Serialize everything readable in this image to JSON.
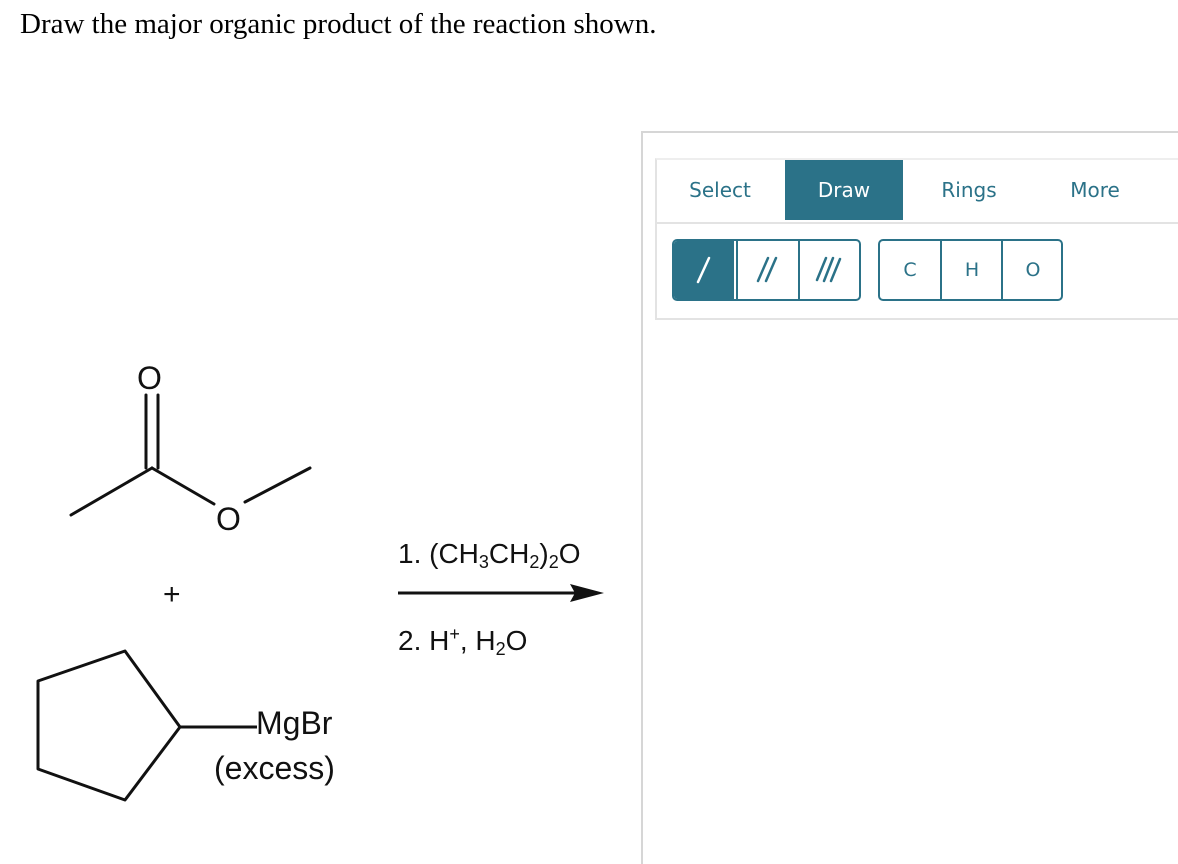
{
  "question": "Draw the major organic product of the reaction shown.",
  "reaction": {
    "ester_carbonyl_o": "O",
    "ester_o": "O",
    "plus": "+",
    "grignard_group": "MgBr",
    "grignard_note": "(excess)",
    "step1_label": "1. (CH",
    "step1_sub1": "3",
    "step1_mid": "CH",
    "step1_sub2": "2",
    "step1_paren": ")",
    "step1_sub3": "2",
    "step1_end": "O",
    "step2_label": "2. H",
    "step2_sup": "+",
    "step2_mid": ", H",
    "step2_sub": "2",
    "step2_end": "O"
  },
  "editor": {
    "tabs": [
      {
        "label": "Select",
        "active": false
      },
      {
        "label": "Draw",
        "active": true
      },
      {
        "label": "Rings",
        "active": false
      },
      {
        "label": "More",
        "active": false
      }
    ],
    "bonds": [
      {
        "name": "single-bond",
        "active": true
      },
      {
        "name": "double-bond",
        "active": false
      },
      {
        "name": "triple-bond",
        "active": false
      }
    ],
    "atoms": [
      "C",
      "H",
      "O"
    ]
  },
  "colors": {
    "accent": "#2b7288",
    "panel_border": "#d6d6d6"
  }
}
